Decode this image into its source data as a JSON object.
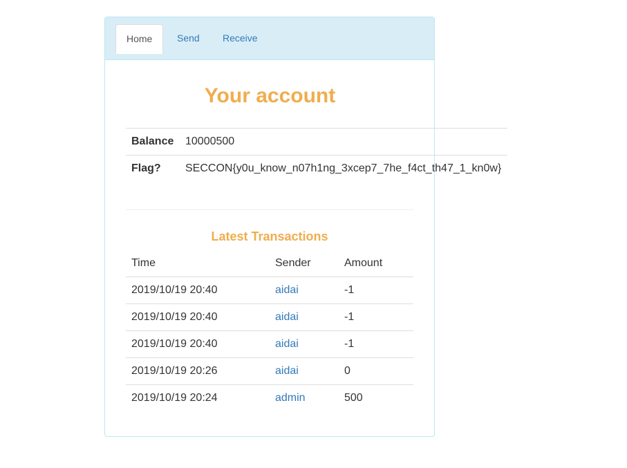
{
  "nav": {
    "tabs": [
      {
        "label": "Home",
        "active": true
      },
      {
        "label": "Send",
        "active": false
      },
      {
        "label": "Receive",
        "active": false
      }
    ]
  },
  "account": {
    "title": "Your account",
    "balance_label": "Balance",
    "balance_value": "10000500",
    "flag_label": "Flag?",
    "flag_value": "SECCON{y0u_know_n07h1ng_3xcep7_7he_f4ct_th47_1_kn0w}"
  },
  "transactions": {
    "title": "Latest Transactions",
    "headers": {
      "time": "Time",
      "sender": "Sender",
      "amount": "Amount"
    },
    "rows": [
      {
        "time": "2019/10/19 20:40",
        "sender": "aidai",
        "amount": "-1"
      },
      {
        "time": "2019/10/19 20:40",
        "sender": "aidai",
        "amount": "-1"
      },
      {
        "time": "2019/10/19 20:40",
        "sender": "aidai",
        "amount": "-1"
      },
      {
        "time": "2019/10/19 20:26",
        "sender": "aidai",
        "amount": "0"
      },
      {
        "time": "2019/10/19 20:24",
        "sender": "admin",
        "amount": "500"
      }
    ]
  },
  "colors": {
    "accent": "#f0ad4e",
    "link": "#337ab7",
    "panel_heading_bg": "#d9edf7",
    "panel_border": "#bce8f1"
  }
}
